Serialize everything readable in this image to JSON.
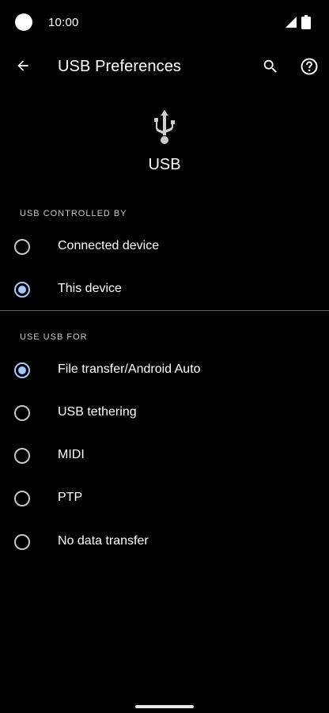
{
  "status_bar": {
    "time": "10:00"
  },
  "app_bar": {
    "title": "USB Preferences"
  },
  "header": {
    "label": "USB"
  },
  "usb_controlled_by": {
    "title": "USB CONTROLLED BY",
    "options": [
      {
        "label": "Connected device",
        "selected": false
      },
      {
        "label": "This device",
        "selected": true
      }
    ]
  },
  "use_usb_for": {
    "title": "USE USB FOR",
    "options": [
      {
        "label": "File transfer/Android Auto",
        "selected": true
      },
      {
        "label": "USB tethering",
        "selected": false
      },
      {
        "label": "MIDI",
        "selected": false
      },
      {
        "label": "PTP",
        "selected": false
      },
      {
        "label": "No data transfer",
        "selected": false
      }
    ]
  },
  "colors": {
    "accent": "#a8c7fa",
    "background": "#000000"
  }
}
